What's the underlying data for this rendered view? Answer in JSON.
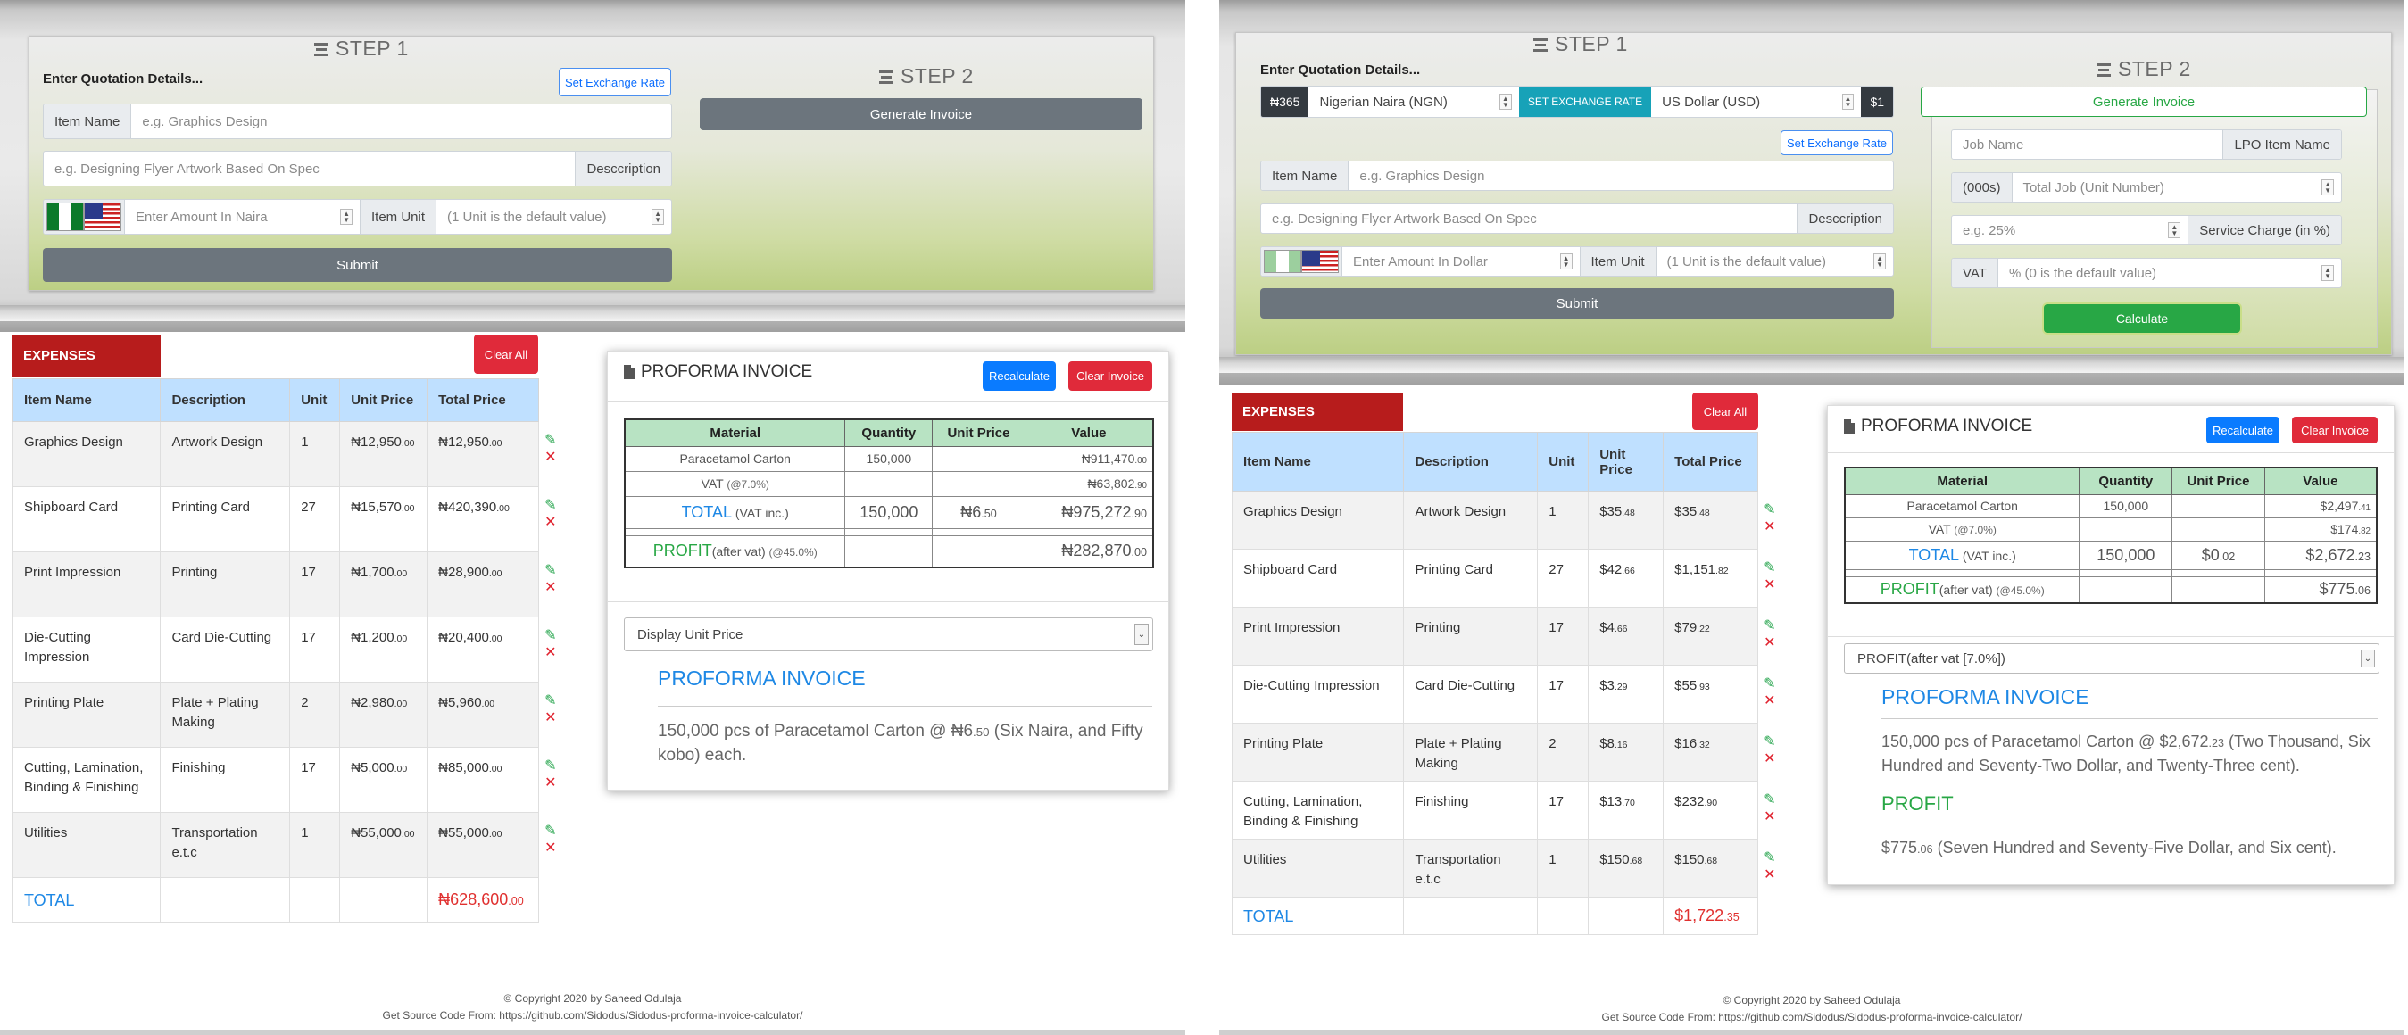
{
  "left": {
    "step1": "STEP 1",
    "step2": "STEP 2",
    "enter_details": "Enter Quotation Details...",
    "set_rate": "Set Exchange Rate",
    "generate": "Generate Invoice",
    "item_name_addon": "Item Name",
    "item_name_ph": "e.g. Graphics Design",
    "desc_ph": "e.g. Designing Flyer Artwork Based On Spec",
    "desc_addon": "Desccription",
    "amount_ph": "Enter Amount In Naira",
    "unit_addon": "Item Unit",
    "unit_ph": "(1 Unit is the default value)",
    "submit": "Submit",
    "expenses": "EXPENSES",
    "clear_all": "Clear All",
    "headers": [
      "Item Name",
      "Description",
      "Unit",
      "Unit Price",
      "Total Price"
    ],
    "rows": [
      {
        "name": "Graphics Design",
        "desc": "Artwork Design",
        "unit": "1",
        "price": "₦12,950",
        "price_dec": ".00",
        "total": "₦12,950",
        "total_dec": ".00"
      },
      {
        "name": "Shipboard Card",
        "desc": "Printing Card",
        "unit": "27",
        "price": "₦15,570",
        "price_dec": ".00",
        "total": "₦420,390",
        "total_dec": ".00"
      },
      {
        "name": "Print Impression",
        "desc": "Printing",
        "unit": "17",
        "price": "₦1,700",
        "price_dec": ".00",
        "total": "₦28,900",
        "total_dec": ".00"
      },
      {
        "name": "Die-Cutting Impression",
        "desc": "Card Die-Cutting",
        "unit": "17",
        "price": "₦1,200",
        "price_dec": ".00",
        "total": "₦20,400",
        "total_dec": ".00"
      },
      {
        "name": "Printing Plate",
        "desc": "Plate + Plating Making",
        "unit": "2",
        "price": "₦2,980",
        "price_dec": ".00",
        "total": "₦5,960",
        "total_dec": ".00"
      },
      {
        "name": "Cutting, Lamination, Binding & Finishing",
        "desc": "Finishing",
        "unit": "17",
        "price": "₦5,000",
        "price_dec": ".00",
        "total": "₦85,000",
        "total_dec": ".00"
      },
      {
        "name": "Utilities",
        "desc": "Transportation e.t.c",
        "unit": "1",
        "price": "₦55,000",
        "price_dec": ".00",
        "total": "₦55,000",
        "total_dec": ".00"
      }
    ],
    "total_label": "TOTAL",
    "total_value": "₦628,600",
    "total_dec": ".00",
    "invoice_title": "PROFORMA INVOICE",
    "recalculate": "Recalculate",
    "clear_invoice": "Clear Invoice",
    "inv_headers": [
      "Material",
      "Quantity",
      "Unit Price",
      "Value"
    ],
    "inv_material": "Paracetamol Carton",
    "inv_qty": "150,000",
    "inv_value": "₦911,470",
    "inv_value_dec": ".00",
    "vat_label": "VAT",
    "vat_pct": "(@7.0%)",
    "vat_value": "₦63,802",
    "vat_value_dec": ".90",
    "tot_label": "TOTAL",
    "tot_sub": "(VAT inc.)",
    "tot_qty": "150,000",
    "tot_unit": "₦6",
    "tot_unit_dec": ".50",
    "tot_value": "₦975,272",
    "tot_value_dec": ".90",
    "profit_label": "PROFIT",
    "profit_sub": "(after vat)",
    "profit_pct": "(@45.0%)",
    "profit_value": "₦282,870",
    "profit_value_dec": ".00",
    "display_select": "Display Unit Price",
    "pi_heading": "PROFORMA INVOICE",
    "pi_text1": "150,000 pcs of Paracetamol Carton @ ₦6",
    "pi_text1_dec": ".50",
    "pi_text2": " (Six Naira, and Fifty kobo) each.",
    "copyright": "© Copyright 2020 by Saheed Odulaja",
    "source": "Get Source Code From: https://github.com/Sidodus/Sidodus-proforma-invoice-calculator/"
  },
  "right": {
    "step1": "STEP 1",
    "step2": "STEP 2",
    "enter_details": "Enter Quotation Details...",
    "rate_chip": "₦365",
    "from_currency": "Nigerian Naira (NGN)",
    "set_rate_btn": "SET EXCHANGE RATE",
    "to_currency": "US Dollar (USD)",
    "usd_chip": "$1",
    "set_rate": "Set Exchange Rate",
    "generate": "Generate Invoice",
    "item_name_addon": "Item Name",
    "item_name_ph": "e.g. Graphics Design",
    "desc_ph": "e.g. Designing Flyer Artwork Based On Spec",
    "desc_addon": "Desccription",
    "amount_ph": "Enter Amount In Dollar",
    "unit_addon": "Item Unit",
    "unit_ph": "(1 Unit is the default value)",
    "submit": "Submit",
    "job_ph": "Job Name",
    "lpo_addon": "LPO Item Name",
    "k_addon": "(000s)",
    "total_job_ph": "Total Job (Unit Number)",
    "service_ph": "e.g. 25%",
    "service_addon": "Service Charge (in %)",
    "vat_addon": "VAT",
    "vat_ph": "% (0 is the default value)",
    "calculate": "Calculate",
    "expenses": "EXPENSES",
    "clear_all": "Clear All",
    "headers": [
      "Item Name",
      "Description",
      "Unit",
      "Unit Price",
      "Total Price"
    ],
    "rows": [
      {
        "name": "Graphics Design",
        "desc": "Artwork Design",
        "unit": "1",
        "price": "$35",
        "price_dec": ".48",
        "total": "$35",
        "total_dec": ".48"
      },
      {
        "name": "Shipboard Card",
        "desc": "Printing Card",
        "unit": "27",
        "price": "$42",
        "price_dec": ".66",
        "total": "$1,151",
        "total_dec": ".82"
      },
      {
        "name": "Print Impression",
        "desc": "Printing",
        "unit": "17",
        "price": "$4",
        "price_dec": ".66",
        "total": "$79",
        "total_dec": ".22"
      },
      {
        "name": "Die-Cutting Impression",
        "desc": "Card Die-Cutting",
        "unit": "17",
        "price": "$3",
        "price_dec": ".29",
        "total": "$55",
        "total_dec": ".93"
      },
      {
        "name": "Printing Plate",
        "desc": "Plate + Plating Making",
        "unit": "2",
        "price": "$8",
        "price_dec": ".16",
        "total": "$16",
        "total_dec": ".32"
      },
      {
        "name": "Cutting, Lamination, Binding & Finishing",
        "desc": "Finishing",
        "unit": "17",
        "price": "$13",
        "price_dec": ".70",
        "total": "$232",
        "total_dec": ".90"
      },
      {
        "name": "Utilities",
        "desc": "Transportation e.t.c",
        "unit": "1",
        "price": "$150",
        "price_dec": ".68",
        "total": "$150",
        "total_dec": ".68"
      }
    ],
    "total_label": "TOTAL",
    "total_value": "$1,722",
    "total_dec": ".35",
    "invoice_title": "PROFORMA INVOICE",
    "recalculate": "Recalculate",
    "clear_invoice": "Clear Invoice",
    "inv_headers": [
      "Material",
      "Quantity",
      "Unit Price",
      "Value"
    ],
    "inv_material": "Paracetamol Carton",
    "inv_qty": "150,000",
    "inv_value": "$2,497",
    "inv_value_dec": ".41",
    "vat_label": "VAT",
    "vat_pct": "(@7.0%)",
    "vat_value": "$174",
    "vat_value_dec": ".82",
    "tot_label": "TOTAL",
    "tot_sub": "(VAT inc.)",
    "tot_qty": "150,000",
    "tot_unit": "$0",
    "tot_unit_dec": ".02",
    "tot_value": "$2,672",
    "tot_value_dec": ".23",
    "profit_label": "PROFIT",
    "profit_sub": "(after vat)",
    "profit_pct": "(@45.0%)",
    "profit_value": "$775",
    "profit_value_dec": ".06",
    "display_select": "PROFIT(after vat [7.0%])",
    "pi_heading": "PROFORMA INVOICE",
    "pi_text1": "150,000 pcs of Paracetamol Carton @ $2,672",
    "pi_text1_dec": ".23",
    "pi_text2": " (Two Thousand, Six Hundred and Seventy-Two Dollar, and Twenty-Three cent).",
    "profit_heading": "PROFIT",
    "profit_text": "$775",
    "profit_text_dec": ".06",
    "profit_text2": " (Seven Hundred and Seventy-Five Dollar, and Six cent).",
    "copyright": "© Copyright 2020 by Saheed Odulaja",
    "source": "Get Source Code From: https://github.com/Sidodus/Sidodus-proforma-invoice-calculator/"
  }
}
